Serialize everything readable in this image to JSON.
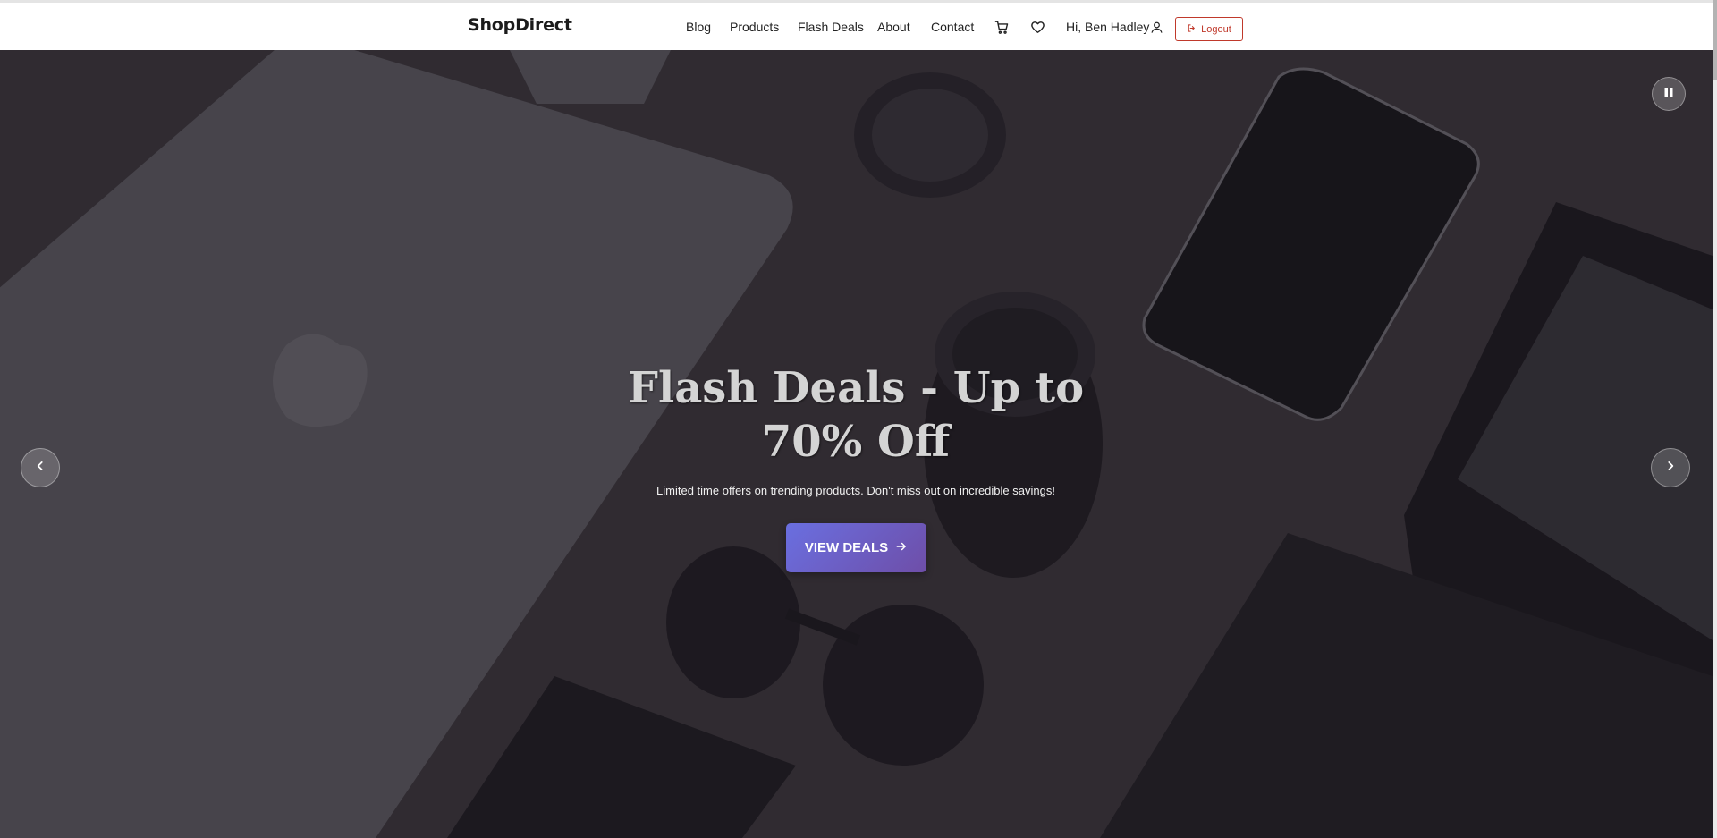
{
  "header": {
    "brand": "ShopDirect",
    "nav": [
      {
        "label": "Blog"
      },
      {
        "label": "Products"
      },
      {
        "label": "Flash Deals"
      },
      {
        "label": "About"
      },
      {
        "label": "Contact"
      }
    ],
    "cart_icon": "cart-icon",
    "wishlist_icon": "heart-icon",
    "greeting": "Hi, Ben Hadley",
    "user_icon": "user-icon",
    "logout_label": "Logout",
    "logout_icon": "logout-icon",
    "logout_color": "#c0392b"
  },
  "hero": {
    "title": "Flash Deals - Up to 70% Off",
    "subtitle": "Limited time offers on trending products. Don't miss out on incredible savings!",
    "cta_label": "VIEW DEALS",
    "cta_icon": "arrow-right-icon",
    "cta_gradient": [
      "#6a6fe0",
      "#6e4ea8"
    ],
    "prev_icon": "chevron-left-icon",
    "next_icon": "chevron-right-icon",
    "pause_icon": "pause-icon"
  }
}
